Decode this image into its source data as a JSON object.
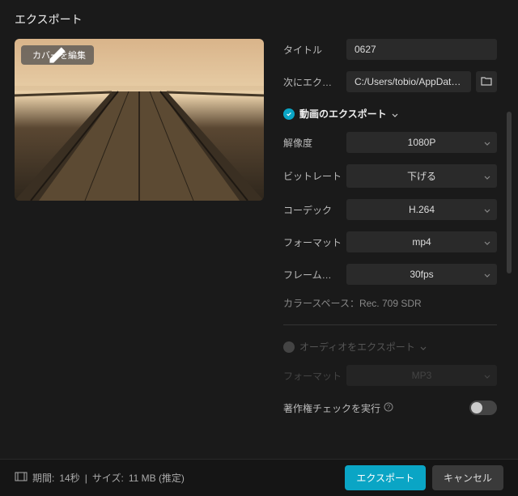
{
  "header": {
    "title": "エクスポート"
  },
  "cover": {
    "edit_label": "カバーを編集"
  },
  "fields": {
    "title_label": "タイトル",
    "title_value": "0627",
    "path_label": "次にエク…",
    "path_value": "C:/Users/tobio/AppDat…"
  },
  "video_section": {
    "header": "動画のエクスポート",
    "resolution_label": "解像度",
    "resolution_value": "1080P",
    "bitrate_label": "ビットレート",
    "bitrate_value": "下げる",
    "codec_label": "コーデック",
    "codec_value": "H.264",
    "format_label": "フォーマット",
    "format_value": "mp4",
    "framerate_label": "フレーム…",
    "framerate_value": "30fps",
    "colorspace_label": "カラースペース：",
    "colorspace_value": "Rec. 709 SDR"
  },
  "audio_section": {
    "header": "オーディオをエクスポート",
    "format_label": "フォーマット",
    "format_value": "MP3"
  },
  "copyright": {
    "label": "著作権チェックを実行"
  },
  "footer": {
    "duration_label": "期間:",
    "duration_value": "14秒",
    "size_label": "サイズ:",
    "size_value": "11 MB (推定)",
    "export_btn": "エクスポート",
    "cancel_btn": "キャンセル"
  }
}
